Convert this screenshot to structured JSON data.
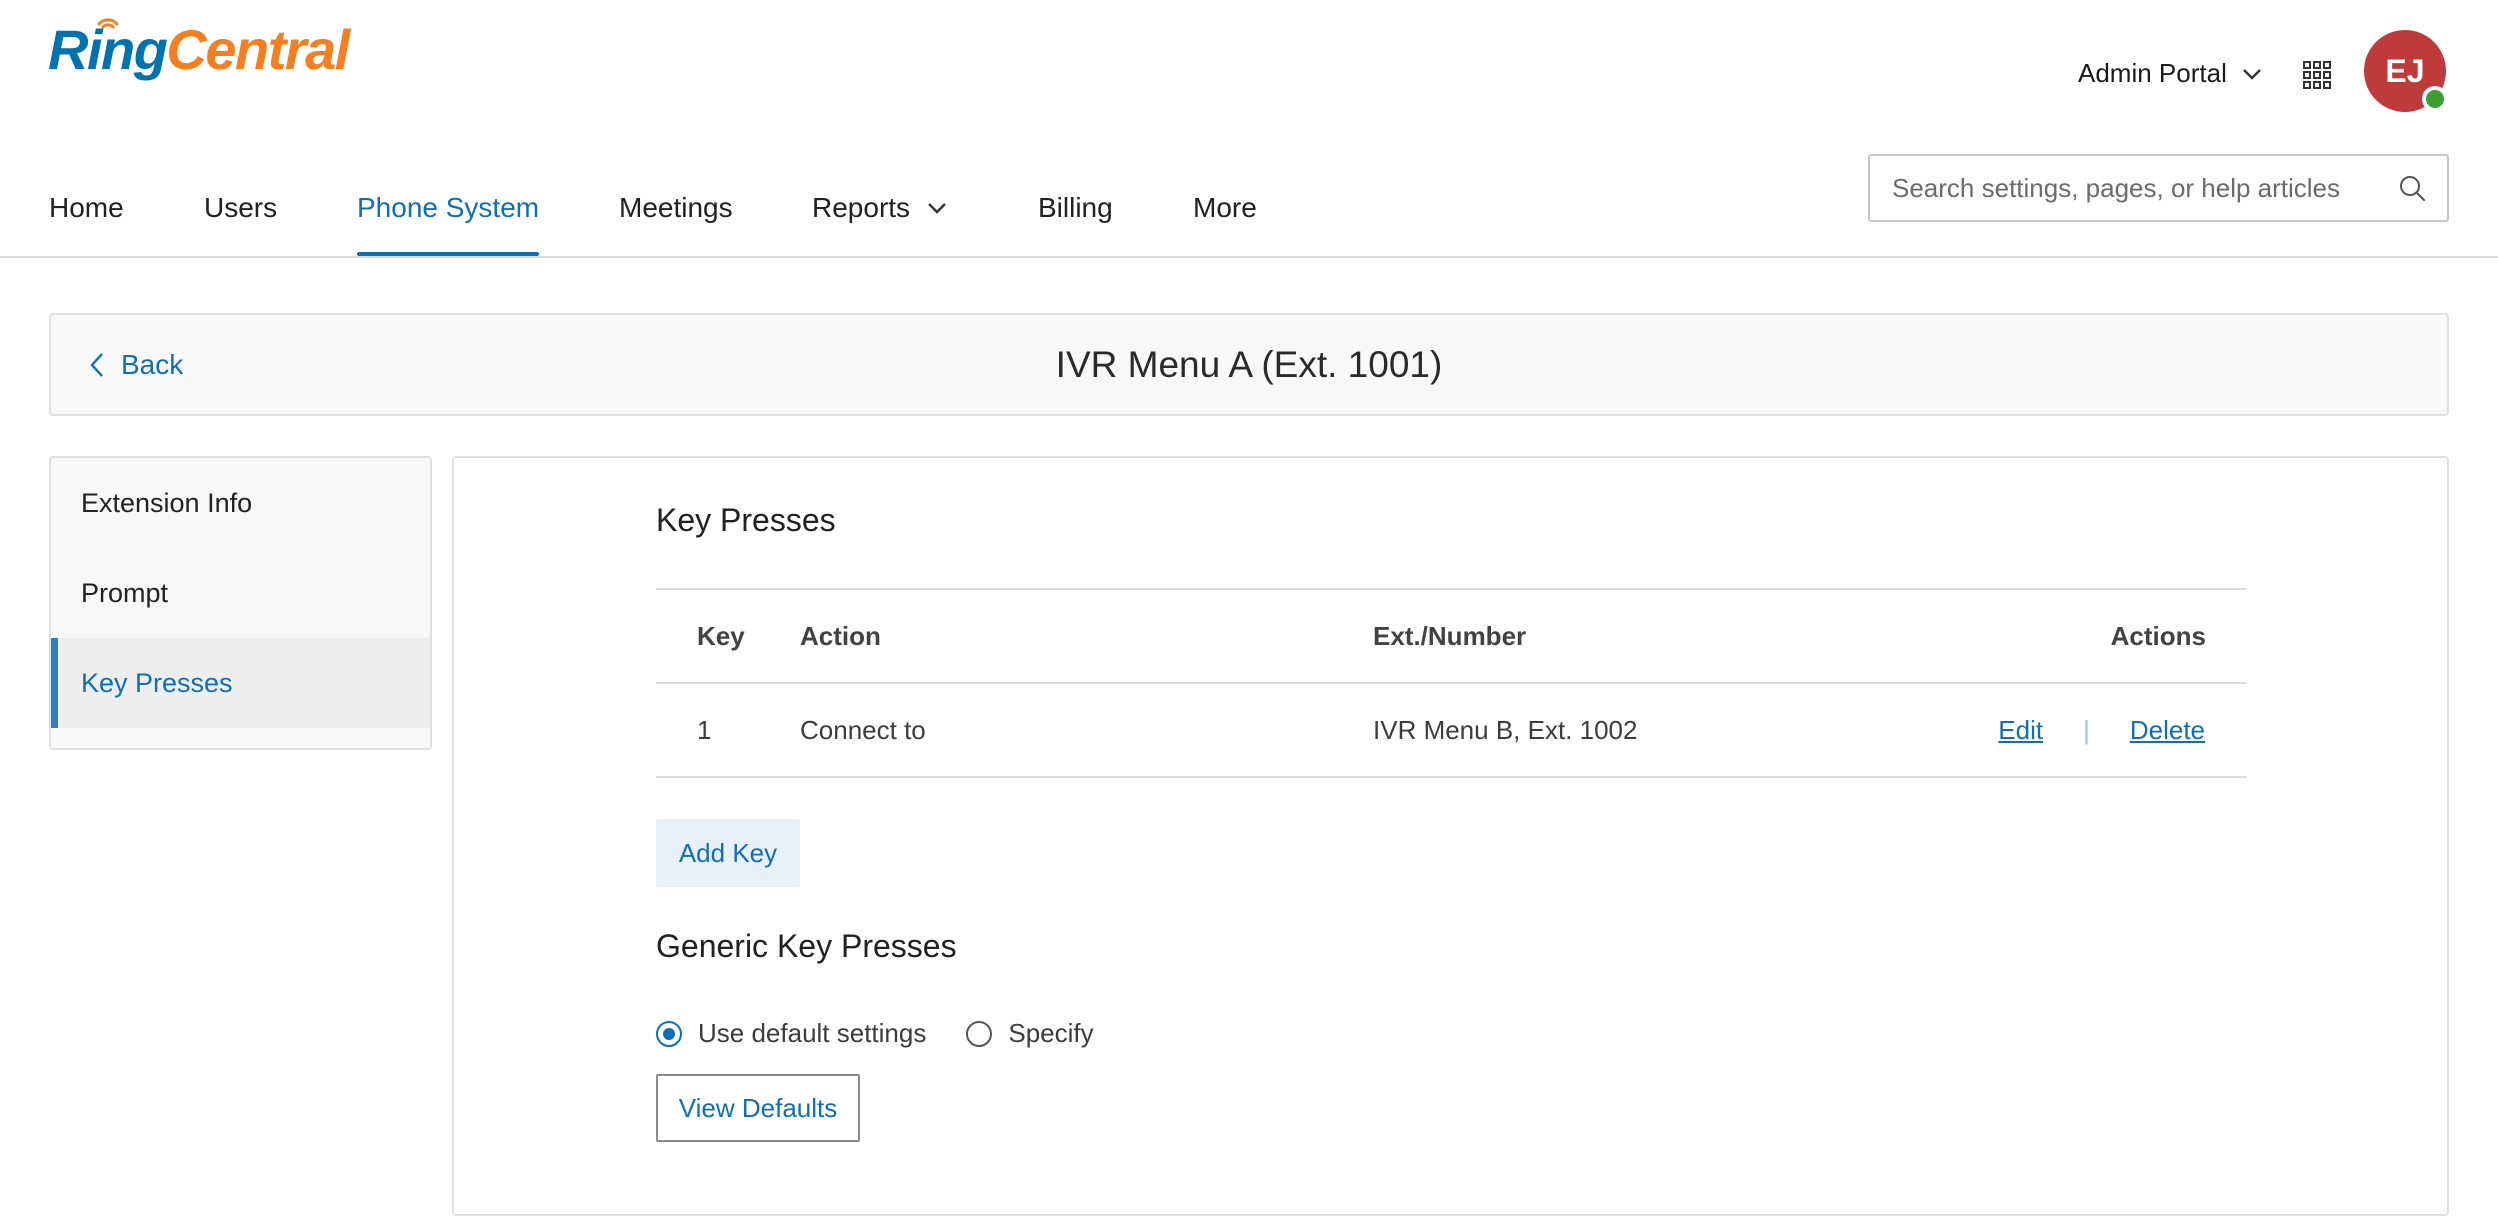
{
  "brand": {
    "logo_part1": "Ring",
    "logo_part2": "Central",
    "ring_color": "#0073ae",
    "central_color": "#f47f20"
  },
  "header": {
    "portal_label": "Admin Portal",
    "apps_icon": "grid-icon",
    "avatar_initials": "EJ",
    "avatar_color": "#bf3b3b",
    "presence_color": "#3e9c35"
  },
  "nav": {
    "items": [
      {
        "label": "Home"
      },
      {
        "label": "Users"
      },
      {
        "label": "Phone System",
        "active": true
      },
      {
        "label": "Meetings"
      },
      {
        "label": "Reports",
        "has_dropdown": true
      },
      {
        "label": "Billing"
      },
      {
        "label": "More"
      }
    ],
    "accent_color": "#0f6fb5"
  },
  "search": {
    "placeholder": "Search settings, pages, or help articles",
    "value": ""
  },
  "page": {
    "back_label": "Back",
    "title": "IVR Menu A (Ext. 1001)"
  },
  "sidebar": {
    "items": [
      {
        "label": "Extension Info"
      },
      {
        "label": "Prompt"
      },
      {
        "label": "Key Presses",
        "active": true
      }
    ]
  },
  "key_presses": {
    "heading": "Key Presses",
    "columns": {
      "key": "Key",
      "action": "Action",
      "ext": "Ext./Number",
      "actions": "Actions"
    },
    "rows": [
      {
        "key": "1",
        "action": "Connect to",
        "ext": "IVR Menu B, Ext. 1002",
        "edit": "Edit",
        "delete": "Delete"
      }
    ],
    "add_key_label": "Add Key"
  },
  "generic_key_presses": {
    "heading": "Generic Key Presses",
    "options": [
      {
        "label": "Use default settings",
        "checked": true
      },
      {
        "label": "Specify",
        "checked": false
      }
    ],
    "view_defaults_label": "View Defaults"
  }
}
